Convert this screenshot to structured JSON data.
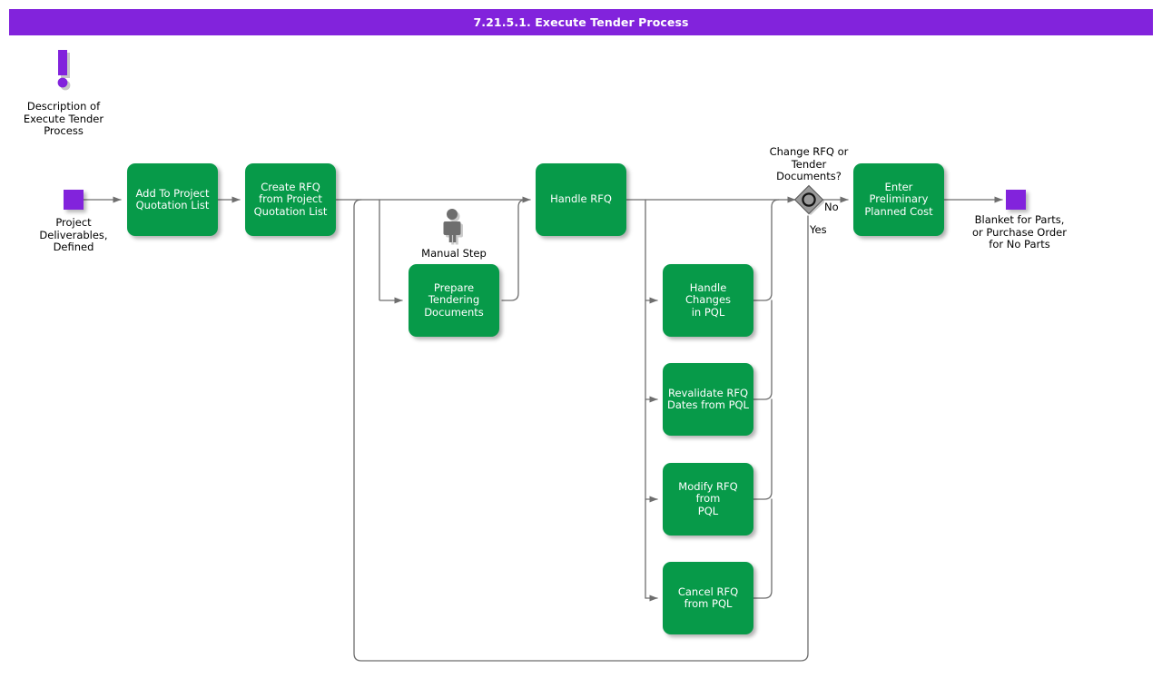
{
  "titlebar": {
    "title": "7.21.5.1. Execute Tender Process",
    "bg_color": "#8223dc",
    "text_color": "#ffffff"
  },
  "theme": {
    "activity_color": "#079a49",
    "terminator_color": "#8223dc",
    "decision_color": "#9a9a9a",
    "connector_color": "#666666",
    "manual_icon_color": "#6e6e6e"
  },
  "description_marker": {
    "icon": "exclamation-icon",
    "label": "Description of\nExecute Tender\nProcess"
  },
  "terminators": [
    {
      "id": "start",
      "name": "start-terminator",
      "label": "Project\nDeliverables,\nDefined"
    },
    {
      "id": "end",
      "name": "end-terminator",
      "label": "Blanket for Parts,\nor Purchase Order\nfor No Parts"
    }
  ],
  "nodes": [
    {
      "id": "add_pql",
      "label": "Add To Project\nQuotation List"
    },
    {
      "id": "create_rfq",
      "label": "Create RFQ\nfrom Project\nQuotation List"
    },
    {
      "id": "prepare_docs",
      "label": "Prepare\nTendering\nDocuments"
    },
    {
      "id": "handle_rfq",
      "label": "Handle RFQ"
    },
    {
      "id": "handle_changes",
      "label": "Handle Changes\nin PQL"
    },
    {
      "id": "revalidate",
      "label": "Revalidate RFQ\nDates from PQL"
    },
    {
      "id": "modify_rfq",
      "label": "Modify RFQ from\nPQL"
    },
    {
      "id": "cancel_rfq",
      "label": "Cancel RFQ\nfrom PQL"
    },
    {
      "id": "enter_cost",
      "label": "Enter\nPreliminary\nPlanned Cost"
    }
  ],
  "manual_step": {
    "icon": "person-icon",
    "label": "Manual Step"
  },
  "decision": {
    "id": "change_rfq",
    "name": "decision-change-rfq",
    "label": "Change RFQ or\nTender\nDocuments?",
    "branches": [
      {
        "id": "no",
        "label": "No"
      },
      {
        "id": "yes",
        "label": "Yes"
      }
    ]
  }
}
